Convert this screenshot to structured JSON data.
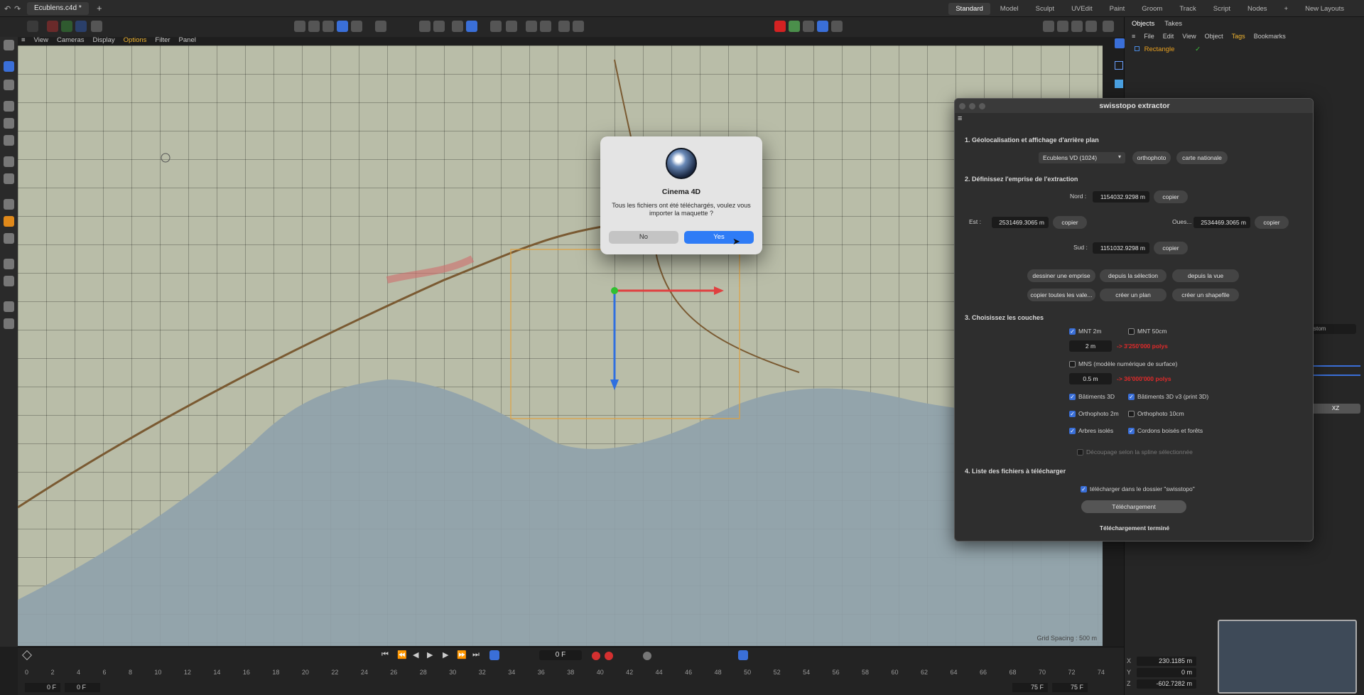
{
  "app": {
    "document_tab": "Ecublens.c4d *",
    "layout_tabs": [
      "Standard",
      "Model",
      "Sculpt",
      "UVEdit",
      "Paint",
      "Groom",
      "Track",
      "Script",
      "Nodes"
    ],
    "active_layout": "Standard",
    "new_layouts": "New Layouts"
  },
  "viewport": {
    "menu": [
      "View",
      "Cameras",
      "Display",
      "Options",
      "Filter",
      "Panel"
    ],
    "active_menu": "Options",
    "grid_spacing": "Grid Spacing : 500 m"
  },
  "objects_panel": {
    "tabs": [
      "Objects",
      "Takes"
    ],
    "menu": [
      "File",
      "Edit",
      "View",
      "Object",
      "Tags",
      "Bookmarks"
    ],
    "active_menu": "Tags",
    "object_name": "Rectangle"
  },
  "plugin": {
    "title": "swisstopo extractor",
    "section1": "1. Géolocalisation et affichage d'arrière plan",
    "location_select": "Ecublens VD (1024)",
    "btn_orthophoto": "orthophoto",
    "btn_carte": "carte nationale",
    "section2": "2. Définissez l'emprise de l'extraction",
    "nord_label": "Nord :",
    "nord_value": "1154032.9298 m",
    "est_label": "Est :",
    "est_value": "2531469.3065 m",
    "ouest_label": "Oues...",
    "ouest_value": "2534469.3065 m",
    "sud_label": "Sud :",
    "sud_value": "1151032.9298 m",
    "copier": "copier",
    "btn_dessiner": "dessiner une emprise",
    "btn_selection": "depuis la sélection",
    "btn_vue": "depuis la vue",
    "btn_copier_toutes": "copier toutes les vale...",
    "btn_plan": "créer un plan",
    "btn_shapefile": "créer un shapefile",
    "section3": "3. Choisissez les couches",
    "mnt2": "MNT 2m",
    "mnt50": "MNT 50cm",
    "mnt_res": "2 m",
    "mnt_polys": "-> 3'250'000 polys",
    "mns": "MNS (modèle numérique de surface)",
    "mns_res": "0.5 m",
    "mns_polys": "-> 36'000'000 polys",
    "bat3d": "Bâtiments 3D",
    "bat3dv3": "Bâtiments 3D v3 (print 3D)",
    "ortho2": "Orthophoto 2m",
    "ortho10": "Orthophoto 10cm",
    "arbres": "Arbres isolés",
    "cordons": "Cordons boisés et forêts",
    "decoupage": "Découpage selon la spline sélectionnée",
    "section4": "4. Liste des fichiers à télécharger",
    "dl_folder": "télécharger dans le dossier \"swisstopo\"",
    "btn_dl": "Téléchargement",
    "status": "Téléchargement terminé"
  },
  "dialog": {
    "title": "Cinema 4D",
    "message": "Tous les fichiers ont été téléchargés, voulez vous importer la maquette ?",
    "no": "No",
    "yes": "Yes"
  },
  "timeline": {
    "frame": "0 F",
    "start": "0 F",
    "start2": "0 F",
    "end": "75 F",
    "end2": "75 F",
    "ticks": [
      "0",
      "2",
      "4",
      "6",
      "8",
      "10",
      "12",
      "14",
      "16",
      "18",
      "20",
      "22",
      "24",
      "26",
      "28",
      "30",
      "32",
      "34",
      "36",
      "38",
      "40",
      "42",
      "44",
      "46",
      "48",
      "50",
      "52",
      "54",
      "56",
      "58",
      "60",
      "62",
      "64",
      "66",
      "68",
      "70",
      "72",
      "74"
    ]
  },
  "coords": {
    "x_label": "X",
    "x": "230.1185 m",
    "y_label": "Y",
    "y": "0 m",
    "z_label": "Z",
    "z": "-602.7282 m"
  },
  "attributes": {
    "mode": "stom",
    "axis": "XZ"
  }
}
